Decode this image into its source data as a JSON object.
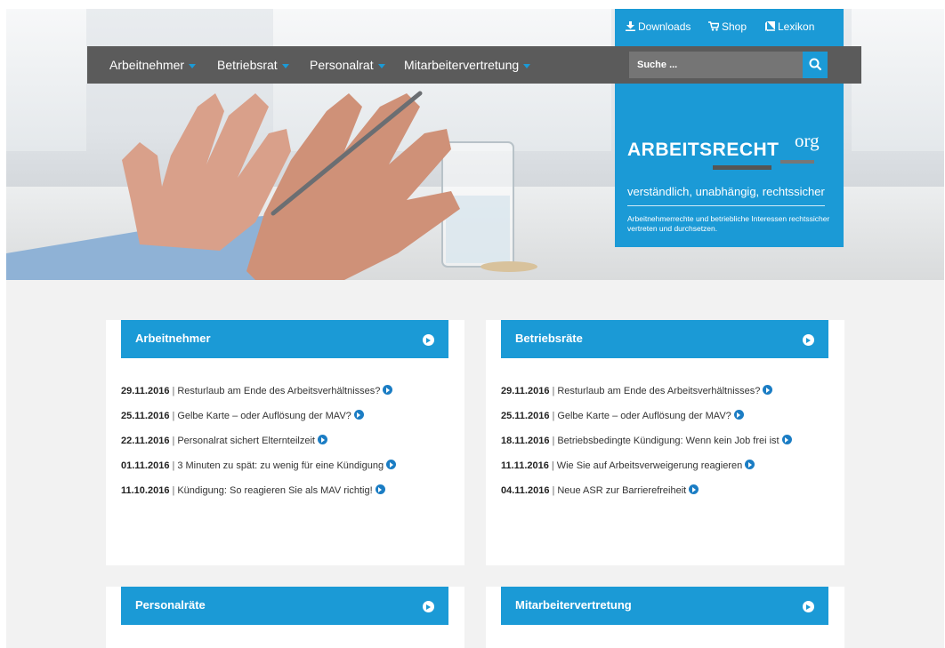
{
  "nav": {
    "items": [
      {
        "label": "Arbeitnehmer"
      },
      {
        "label": "Betriebsrat"
      },
      {
        "label": "Personalrat"
      },
      {
        "label": "Mitarbeitervertretung"
      }
    ]
  },
  "search": {
    "placeholder": "Suche ..."
  },
  "top_links": {
    "downloads": "Downloads",
    "shop": "Shop",
    "lexikon": "Lexikon"
  },
  "brand": {
    "name": "ARBEITSRECHT",
    "tld": "org",
    "tagline": "verständlich, unabhängig, rechtssicher",
    "description": "Arbeitnehmerrechte und betriebliche Interessen rechtssicher vertreten und durchsetzen."
  },
  "cards": [
    {
      "title": "Arbeitnehmer",
      "news": [
        {
          "date": "29.11.2016",
          "text": "Resturlaub am Ende des Arbeitsverhältnisses?"
        },
        {
          "date": "25.11.2016",
          "text": "Gelbe Karte – oder Auflösung der MAV?"
        },
        {
          "date": "22.11.2016",
          "text": "Personalrat sichert Elternteilzeit"
        },
        {
          "date": "01.11.2016",
          "text": "3 Minuten zu spät: zu wenig für eine Kündigung"
        },
        {
          "date": "11.10.2016",
          "text": "Kündigung: So reagieren Sie als MAV richtig!"
        }
      ]
    },
    {
      "title": "Betriebsräte",
      "news": [
        {
          "date": "29.11.2016",
          "text": "Resturlaub am Ende des Arbeitsverhältnisses?"
        },
        {
          "date": "25.11.2016",
          "text": "Gelbe Karte – oder Auflösung der MAV?"
        },
        {
          "date": "18.11.2016",
          "text": "Betriebsbedingte Kündigung: Wenn kein Job frei ist"
        },
        {
          "date": "11.11.2016",
          "text": "Wie Sie auf Arbeitsverweigerung reagieren"
        },
        {
          "date": "04.11.2016",
          "text": "Neue ASR zur Barrierefreiheit"
        }
      ]
    },
    {
      "title": "Personalräte"
    },
    {
      "title": "Mitarbeitervertretung"
    }
  ],
  "colors": {
    "accent": "#1b9ad6",
    "nav_bg": "#5b5b5b",
    "page_bg": "#f2f2f2",
    "card_bg": "#ffffff"
  },
  "icons": {
    "downloads": "download-icon",
    "shop": "cart-icon",
    "lexikon": "book-icon",
    "search": "search-icon",
    "card_link": "circle-arrow-right-icon"
  }
}
